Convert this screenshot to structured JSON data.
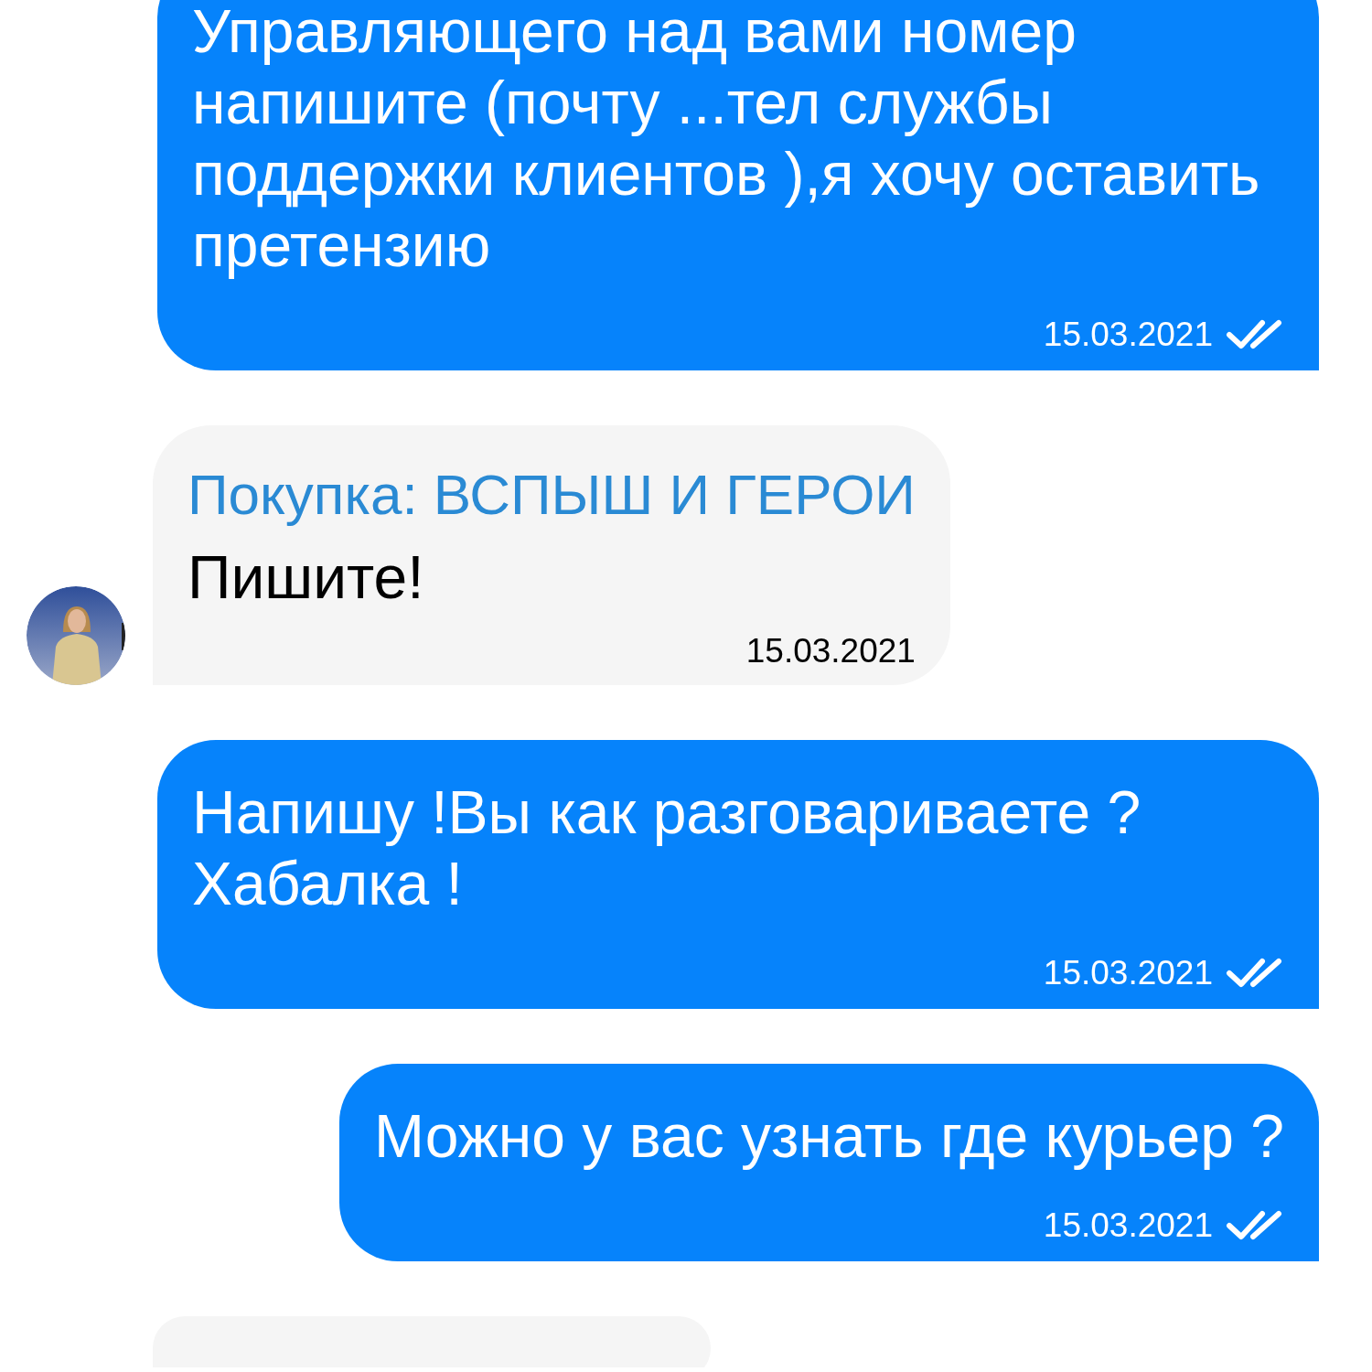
{
  "messages": [
    {
      "kind": "outgoing",
      "text": "Управляющего над вами номер напишите (почту ...тел службы поддержки клиентов ),я хочу оставить претензию",
      "date": "15.03.2021",
      "read": true
    },
    {
      "kind": "incoming",
      "title": "Покупка: ВСПЫШ И ГЕРОИ",
      "text": "Пишите!",
      "date": "15.03.2021"
    },
    {
      "kind": "outgoing",
      "text": "Напишу !Вы как разговариваете ? Хабалка !",
      "date": "15.03.2021",
      "read": true
    },
    {
      "kind": "outgoing",
      "text": "Можно у вас узнать где курьер ?",
      "date": "15.03.2021",
      "read": true
    },
    {
      "kind": "incoming"
    }
  ]
}
